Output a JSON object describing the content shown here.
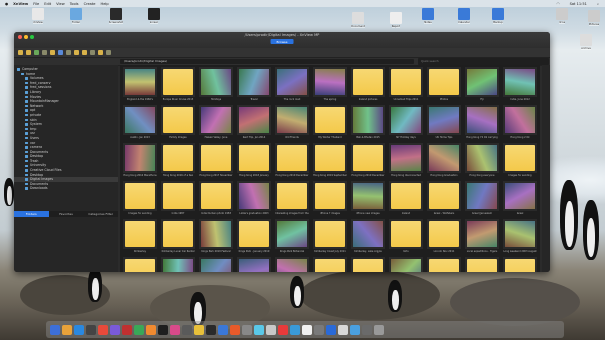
{
  "menubar": {
    "app": "XnView",
    "items": [
      "File",
      "Edit",
      "View",
      "Tools",
      "Create",
      "Help"
    ],
    "clock": "Sat 11:51",
    "status": "XnView MP"
  },
  "desktop_icons": [
    {
      "label": "XnView"
    },
    {
      "label": "Folder"
    },
    {
      "label": "Screenshot"
    },
    {
      "label": "Screen"
    },
    {
      "label": "Document"
    },
    {
      "label": "Report"
    },
    {
      "label": "Notes"
    },
    {
      "label": "Calendar"
    },
    {
      "label": "Backup"
    },
    {
      "label": "Drive"
    },
    {
      "label": "Pictures"
    },
    {
      "label": "Archive"
    }
  ],
  "window": {
    "title": "/Users/prodir/Digital Images/ - XnView MP",
    "browse_label": "Browse",
    "address": "/Users/prodir/Digital Images/",
    "search_placeholder": "Quick search"
  },
  "tree": [
    "Computer",
    "home",
    "Volumes",
    "fred_conserv",
    "fred_sessions",
    "Library",
    "Movies",
    "MountainManager",
    "Network",
    "opt",
    "private",
    "sbin",
    "System",
    "tmp",
    "usr",
    "Users",
    "var",
    "camera",
    "Documents",
    "Desktop",
    "Trash",
    "University",
    "Creative Cloud Files",
    "Desktop",
    "Digital Images",
    "Documents",
    "Downloads"
  ],
  "tree_selected": "Digital Images",
  "tabs": [
    "Folders",
    "Favorites",
    "Categories Filter"
  ],
  "active_tab": "Folders",
  "thumbnails": [
    {
      "t": "photo",
      "l": "England & the 1960's"
    },
    {
      "t": "folder",
      "l": "Europe River Cruise 2013"
    },
    {
      "t": "photo",
      "l": "Holidays"
    },
    {
      "t": "photo",
      "l": "Travel"
    },
    {
      "t": "photo",
      "l": "The rock road"
    },
    {
      "t": "photo",
      "l": "The spring"
    },
    {
      "t": "folder",
      "l": "Ireland pictures"
    },
    {
      "t": "folder",
      "l": "Unnamed Trips 2011"
    },
    {
      "t": "folder",
      "l": "Photos"
    },
    {
      "t": "photo",
      "l": "Fiji"
    },
    {
      "t": "photo",
      "l": "India, June 2012"
    },
    {
      "t": "photo",
      "l": "Austin, Jan 2013"
    },
    {
      "t": "folder",
      "l": "Family Images"
    },
    {
      "t": "photo",
      "l": "Hawaii Valley, June"
    },
    {
      "t": "photo",
      "l": "Kent Trip, Jan 2014"
    },
    {
      "t": "photo",
      "l": "Old Friends"
    },
    {
      "t": "folder",
      "l": "My Winter Thailand"
    },
    {
      "t": "photo",
      "l": "Bali & Bhutan 2015"
    },
    {
      "t": "photo",
      "l": "NY Holiday days"
    },
    {
      "t": "photo",
      "l": "UK Home Tips"
    },
    {
      "t": "photo",
      "l": "Hong Kong 72 Ok carrying"
    },
    {
      "t": "photo",
      "l": "Hong Kong 2 Ok"
    },
    {
      "t": "photo",
      "l": "Hong Kong 2016 Marathons"
    },
    {
      "t": "folder",
      "l": "Hong Kong 2016 of a few"
    },
    {
      "t": "folder",
      "l": "Hong Kong 2017 November"
    },
    {
      "t": "folder",
      "l": "Hong Kong 2018 January"
    },
    {
      "t": "folder",
      "l": "Hong Kong 2019 December"
    },
    {
      "t": "folder",
      "l": "Hong Kong 2019 September"
    },
    {
      "t": "folder",
      "l": "Hong Kong 2019 December"
    },
    {
      "t": "photo",
      "l": "Hong Kong disconnected"
    },
    {
      "t": "photo",
      "l": "Hong Kong Graduation"
    },
    {
      "t": "photo",
      "l": "Hong Kong everyone"
    },
    {
      "t": "folder",
      "l": "Images for sending"
    },
    {
      "t": "folder",
      "l": "Images for sending"
    },
    {
      "t": "folder",
      "l": "India 1987"
    },
    {
      "t": "folder",
      "l": "India Durban photo 1983"
    },
    {
      "t": "photo",
      "l": "Lizzie's graduation 2003"
    },
    {
      "t": "folder",
      "l": "Interesting images from the"
    },
    {
      "t": "folder",
      "l": "iPhone 7 images"
    },
    {
      "t": "photo",
      "l": "iPhone new images"
    },
    {
      "t": "folder",
      "l": "Ireland"
    },
    {
      "t": "folder",
      "l": "Israel - Wolfsbers"
    },
    {
      "t": "photo",
      "l": "Israel (Jerusalem"
    },
    {
      "t": "photo",
      "l": "Israel"
    },
    {
      "t": "folder",
      "l": "Kimberley"
    },
    {
      "t": "folder",
      "l": "Kimberley Lunar Car Rental"
    },
    {
      "t": "photo",
      "l": "Kings Park 2019 Festival"
    },
    {
      "t": "folder",
      "l": "Kings Park - January 2019"
    },
    {
      "t": "photo",
      "l": "Kings Park Botanical"
    },
    {
      "t": "folder",
      "l": "Kimberley Coast July 2011"
    },
    {
      "t": "photo",
      "l": "Kimberley, Lake Argyle"
    },
    {
      "t": "folder",
      "l": "Kofu"
    },
    {
      "t": "folder",
      "l": "Lincoln Nov 2011"
    },
    {
      "t": "photo",
      "l": "Local expeditions - Tigers"
    },
    {
      "t": "photo",
      "l": "Long weekend 2003 August"
    },
    {
      "t": "folder",
      "l": ""
    },
    {
      "t": "photo",
      "l": ""
    },
    {
      "t": "photo",
      "l": ""
    },
    {
      "t": "photo",
      "l": ""
    },
    {
      "t": "photo",
      "l": ""
    },
    {
      "t": "folder",
      "l": ""
    },
    {
      "t": "folder",
      "l": ""
    },
    {
      "t": "photo",
      "l": ""
    },
    {
      "t": "folder",
      "l": ""
    },
    {
      "t": "folder",
      "l": ""
    },
    {
      "t": "folder",
      "l": ""
    }
  ],
  "dock_colors": [
    "#3d6fd8",
    "#e8a23a",
    "#2a88e0",
    "#444",
    "#e84a3a",
    "#7a5ad8",
    "#c03030",
    "#3aa858",
    "#f08a30",
    "#1e1e1e",
    "#d84a8a",
    "#5a5a5a",
    "#e8c03a",
    "#2a2a2a",
    "#3a78d8",
    "#e85a2a",
    "#888",
    "#5ac8e8",
    "#c8c8c8",
    "#e83a3a",
    "#3a9ad8",
    "#f0f0f0",
    "#7a7a7a",
    "#2a6ad8",
    "#d8d8d8",
    "#4aa0e0",
    "#6a6a6a",
    "#999"
  ]
}
